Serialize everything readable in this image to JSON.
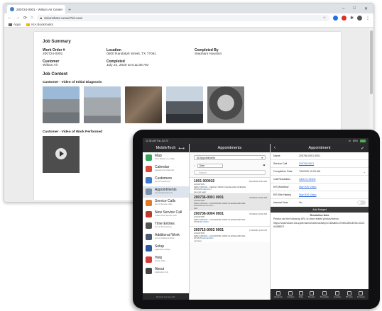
{
  "browser": {
    "tab_title": "200724-0001 - Wilson Air Center",
    "url": "visionshare.xxxxx/?id=xxxx",
    "bookmarks": [
      "Apps",
      "KIA Bookmarks"
    ],
    "new_tab": "+"
  },
  "report": {
    "section_title": "Job Summary",
    "work_order_label": "Work Order #",
    "work_order_value": "200724-0001",
    "location_label": "Location",
    "location_value": "0000 Randolph Street, TX 77061",
    "completed_by_label": "Completed By",
    "completed_by_value": "Stephani Houston",
    "customer_label": "Customer",
    "customer_value": "Wilson Air",
    "completed_label": "Completed",
    "completed_value": "July 24, 2020 at 9:11:06 AM",
    "content_title": "Job Content",
    "video_initial_title": "Customer - Video of Initial Diagnosis",
    "video_performed_title": "Customer - Video of Work Performed"
  },
  "tablet": {
    "status_time": "11:35 AM   Thu Jul 23",
    "battery": "80%",
    "nav_title": "MobileTech",
    "nav_items": [
      {
        "title": "Map",
        "subtitle": "Time Entries on a Map",
        "color": "#3aa35b"
      },
      {
        "title": "Calendar",
        "subtitle": "Agenda and Calendar",
        "color": "#d84a3a"
      },
      {
        "title": "Customers",
        "subtitle": "List of Customers",
        "color": "#3c7bd0"
      },
      {
        "title": "Appointments",
        "subtitle": "List of Appointments",
        "color": "#7c8fa8"
      },
      {
        "title": "Service Calls",
        "subtitle": "List of Service Calls",
        "color": "#e07b2a"
      },
      {
        "title": "New Service Call",
        "subtitle": "Create New Service Call",
        "color": "#c0392b"
      },
      {
        "title": "Time Entries",
        "subtitle": "List of Time Entries",
        "color": "#555555"
      },
      {
        "title": "Additional Work",
        "subtitle": "List of Additional Work",
        "color": "#4a5a70"
      },
      {
        "title": "Setup",
        "subtitle": "Application Setup",
        "color": "#2c5aa0"
      },
      {
        "title": "Help",
        "subtitle": "Online Help",
        "color": "#d33c3c"
      },
      {
        "title": "About",
        "subtitle": "Application Info",
        "color": "#444444"
      }
    ],
    "nav_footer": "Remote set | see info",
    "list_title": "Appointments",
    "filter_label": "All Appointments",
    "sort_label": "Date",
    "search_placeholder": "Search",
    "appointments": [
      {
        "id": "1001 000015",
        "date": "6/23/2020 8:00 AM",
        "line1": "LOCATION",
        "line2": "MAIN OFFICE - CEDAR 15000 CLEVELAND AVENUE",
        "status_label": "STATUS",
        "status": "DEFAULT",
        "extra": "new job appt"
      },
      {
        "id": "200736-0001 0001",
        "date": "7/6/2020 10:00 AM",
        "line1": "LOCATION",
        "line2": "MAIN OFFICE - ACCURATE 10300 CLEVELAND AVE",
        "status_label": "STATUS",
        "status": "RECEIVED",
        "extra": "120"
      },
      {
        "id": "200736-0004 0001",
        "date": "7/6/2020 10:00 AM",
        "line1": "LOCATION",
        "line2": "MAIN OFFICE - ACCURATE 10300 CLEVELAND AVE",
        "status_label": "STATUS",
        "status": "OPEN",
        "extra": ""
      },
      {
        "id": "200715-0002 0001",
        "date": "7/15/2020 2:00 PM",
        "line1": "LOCATION",
        "line2": "MAIN OFFICE - ACCURATE 10300 CLEVELAND AVE",
        "status_label": "STATUS",
        "status": "RECEIVED",
        "extra": "not here"
      }
    ],
    "detail_title": "Appointment",
    "detail_rows": [
      {
        "key": "Name",
        "value": "200766-0001 0001",
        "link": false
      },
      {
        "key": "Service Call",
        "value": "200766-0001",
        "link": true
      },
      {
        "key": "Completion Date",
        "value": "7/6/2020 10:00 AM",
        "link": false
      },
      {
        "key": "Call Resolution",
        "value": "Click To Select",
        "link": true
      },
      {
        "key": "KIS Workflow",
        "value": "Start KIS Video",
        "link": true
      },
      {
        "key": "KIS Site History",
        "value": "Start KIS Video",
        "link": true
      },
      {
        "key": "Internal Note",
        "value": "No",
        "link": false
      }
    ],
    "add_snippet": "Add Snippet",
    "resolution_title": "Resolution Note",
    "resolution_text": "Please use the following URL to view related photos/videos:",
    "resolution_url": "https://visionshare.kis.systems/forlinclen/activity/CXDA8MC-E39B-8E5-8E53-3C0CAA88BC2",
    "toolbar": [
      "Resolution",
      "Contacts",
      "Tasks",
      "Time Ent.",
      "Time Estim.",
      "Inventory",
      "RT Links",
      "Summary"
    ]
  }
}
